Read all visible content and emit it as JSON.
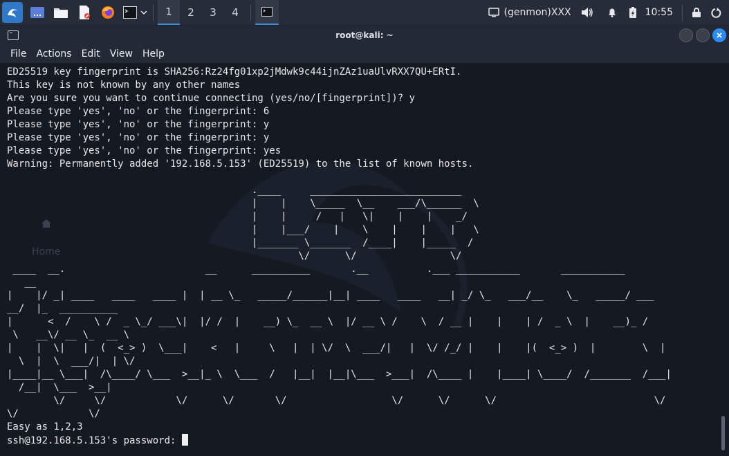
{
  "panel": {
    "workspaces": [
      "1",
      "2",
      "3",
      "4"
    ],
    "genmon_label": "(genmon)XXX",
    "clock": "10:55"
  },
  "window": {
    "title": "root@kali: ~"
  },
  "menu": {
    "file": "File",
    "actions": "Actions",
    "edit": "Edit",
    "view": "View",
    "help": "Help"
  },
  "background": {
    "home_label": "Home"
  },
  "terminal": {
    "lines": [
      "ED25519 key fingerprint is SHA256:Rz24fg01xp2jMdwk9c44ijnZAz1uaUlvRXX7QU+ERtI.",
      "This key is not known by any other names",
      "Are you sure you want to continue connecting (yes/no/[fingerprint])? y",
      "Please type 'yes', 'no' or the fingerprint: 6",
      "Please type 'yes', 'no' or the fingerprint: y",
      "Please type 'yes', 'no' or the fingerprint: y",
      "Please type 'yes', 'no' or the fingerprint: yes",
      "Warning: Permanently added '192.168.5.153' (ED25519) to the list of known hosts.",
      "",
      "                                          .____     __________________________",
      "                                          |    |    \\_____  \\__    ___/\\______  \\",
      "                                          |    |     /   |   \\|    |    |    _/",
      "                                          |    |___/    |    \\    |    |    |   \\",
      "                                          |_______ \\_______  /____|    |_____  /",
      "                                                  \\/      \\/                \\/",
      " ____  __.                        __      __________       .__          .___ ___________       ___________",
      "   __",
      "|    |/ _| ____   ____   ____ |  | __ \\_   _____/______|__| ____   ____   __| _/ \\_   ___/__    \\_   _____/ ___",
      "__/  |_  __________",
      "|      <  /    \\ /  _ \\_/ ___\\|  |/ /  |    __) \\_  __ \\  |/ __ \\ /    \\  / __ |    |    | /  _ \\  |    __)_ /",
      " \\   __\\/ __ \\_  __ \\",
      "|    |  \\|   |  (  <_> )  \\___|    <   |     \\   |  | \\/  \\  ___/|   |  \\/ /_/ |    |    |(  <_> )  |        \\  |",
      "  \\  |  \\  ___/|  | \\/",
      "|____|__ \\___|  /\\____/ \\___  >__|_ \\  \\___  /   |__|  |__|\\___  >___|  /\\____ |    |____| \\____/  /_______  /___|",
      "  /__|  \\___  >__|",
      "        \\/     \\/            \\/      \\/       \\/                  \\/      \\/      \\/                           \\/",
      "\\/            \\/",
      "Easy as 1,2,3"
    ],
    "prompt": "ssh@192.168.5.153's password: "
  }
}
